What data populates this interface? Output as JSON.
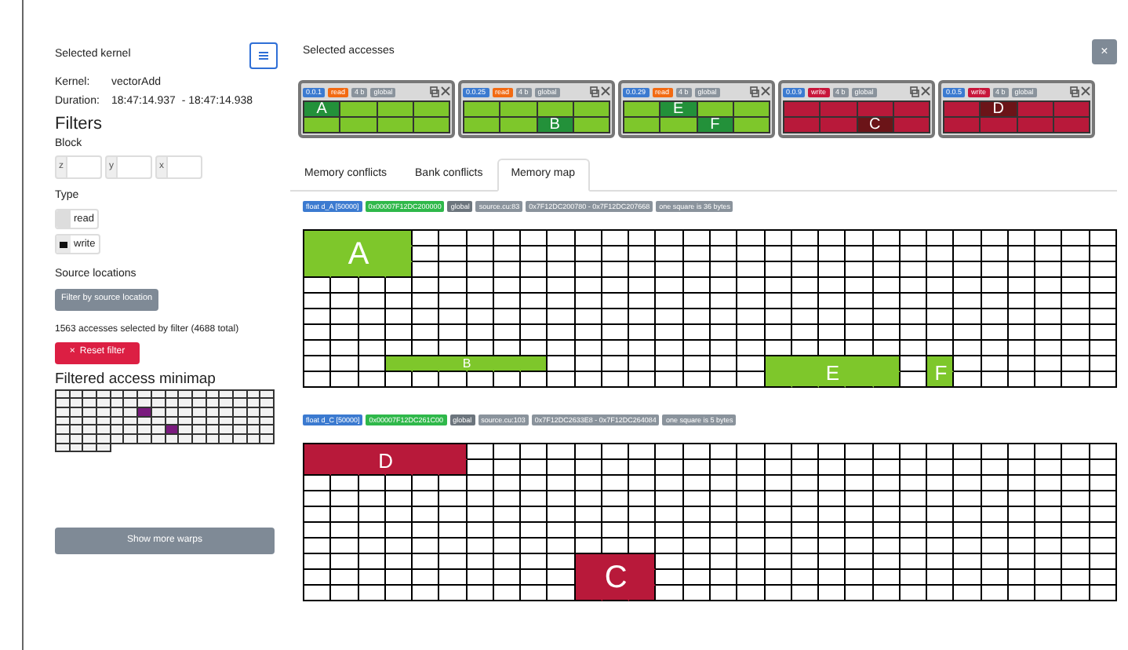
{
  "kernel": {
    "title": "Selected kernel",
    "name_label": "Kernel:",
    "name": "vectorAdd",
    "duration_label": "Duration:",
    "start": "18:47:14.937",
    "end": "- 18:47:14.938"
  },
  "filters": {
    "title": "Filters",
    "block_label": "Block",
    "block_fields": [
      "z",
      "y",
      "x"
    ],
    "type_label": "Type",
    "types": [
      {
        "label": "read",
        "checked": false
      },
      {
        "label": "write",
        "checked": true
      }
    ],
    "source_label": "Source locations",
    "source_button": "Filter by source location",
    "summary": "1563 accesses selected by filter (4688 total)",
    "reset_button": "Reset filter",
    "reset_icon": "×"
  },
  "minimap": {
    "title": "Filtered access minimap",
    "rows": [
      [
        false,
        false,
        false,
        false,
        false,
        false,
        false,
        false,
        false,
        false,
        false,
        false,
        false,
        false,
        false,
        false
      ],
      [
        false,
        false,
        false,
        false,
        false,
        false,
        false,
        false,
        false,
        false,
        false,
        false,
        false,
        false,
        false,
        false
      ],
      [
        false,
        false,
        false,
        false,
        false,
        false,
        true,
        false,
        false,
        false,
        false,
        false,
        false,
        false,
        false,
        false
      ],
      [
        false,
        false,
        false,
        false,
        false,
        false,
        false,
        false,
        false,
        false,
        false,
        false,
        false,
        false,
        false,
        false
      ],
      [
        false,
        false,
        false,
        false,
        false,
        false,
        false,
        false,
        true,
        false,
        false,
        false,
        false,
        false,
        false,
        false
      ],
      [
        false,
        false,
        false,
        false,
        false,
        false,
        false,
        false,
        false,
        false,
        false,
        false,
        false,
        false,
        false,
        false
      ],
      [
        false,
        false,
        false,
        false
      ]
    ]
  },
  "more_button": "Show more warps",
  "accesses": {
    "title": "Selected accesses",
    "close": "×",
    "cards": [
      {
        "thread": "0.0.1",
        "access": "read",
        "size": "4 b",
        "space": "global",
        "labels": [
          "A"
        ],
        "cells": [
          [
            true,
            false,
            false,
            false
          ],
          [
            false,
            false,
            false,
            false
          ]
        ]
      },
      {
        "thread": "0.0.25",
        "access": "read",
        "size": "4 b",
        "space": "global",
        "labels": [
          "B"
        ],
        "cells": [
          [
            false,
            false,
            false,
            false
          ],
          [
            false,
            false,
            true,
            false
          ]
        ]
      },
      {
        "thread": "0.0.29",
        "access": "read",
        "size": "4 b",
        "space": "global",
        "labels": [
          "E",
          "F"
        ],
        "cells": [
          [
            false,
            true,
            false,
            false
          ],
          [
            false,
            false,
            true,
            false
          ]
        ]
      },
      {
        "thread": "0.0.9",
        "access": "write",
        "size": "4 b",
        "space": "global",
        "labels": [
          "C"
        ],
        "cells": [
          [
            false,
            false,
            false,
            false
          ],
          [
            false,
            false,
            true,
            false
          ]
        ]
      },
      {
        "thread": "0.0.5",
        "access": "write",
        "size": "4 b",
        "space": "global",
        "labels": [
          "D"
        ],
        "cells": [
          [
            false,
            true,
            false,
            false
          ],
          [
            false,
            false,
            false,
            false
          ]
        ]
      }
    ]
  },
  "tabs": [
    {
      "label": "Memory conflicts",
      "selected": false
    },
    {
      "label": "Bank conflicts",
      "selected": false
    },
    {
      "label": "Memory map",
      "selected": true
    }
  ],
  "memory_maps": [
    {
      "variable": "float d_A [50000]",
      "base": "0x00007F12DC200000",
      "space": "global",
      "source": "source.cu:83",
      "range": "0x7F12DC200780 - 0x7F12DC207668",
      "scale": "one square is 36 bytes",
      "kind": "read",
      "labels": [
        "A",
        "B",
        "E",
        "F"
      ],
      "cells": [
        [
          true,
          true,
          true,
          true,
          false,
          false,
          false,
          false,
          false,
          false,
          false,
          false,
          false,
          false,
          false,
          false,
          false,
          false,
          false,
          false,
          false,
          false,
          false,
          false,
          false,
          false,
          false,
          false,
          false,
          false
        ],
        [
          true,
          true,
          true,
          true,
          false,
          false,
          false,
          false,
          false,
          false,
          false,
          false,
          false,
          false,
          false,
          false,
          false,
          false,
          false,
          false,
          false,
          false,
          false,
          false,
          false,
          false,
          false,
          false,
          false,
          false
        ],
        [
          true,
          true,
          true,
          true,
          false,
          false,
          false,
          false,
          false,
          false,
          false,
          false,
          false,
          false,
          false,
          false,
          false,
          false,
          false,
          false,
          false,
          false,
          false,
          false,
          false,
          false,
          false,
          false,
          false,
          false
        ],
        [
          false,
          false,
          false,
          false,
          false,
          false,
          false,
          false,
          false,
          false,
          false,
          false,
          false,
          false,
          false,
          false,
          false,
          false,
          false,
          false,
          false,
          false,
          false,
          false,
          false,
          false,
          false,
          false,
          false,
          false
        ],
        [
          false,
          false,
          false,
          false,
          false,
          false,
          false,
          false,
          false,
          false,
          false,
          false,
          false,
          false,
          false,
          false,
          false,
          false,
          false,
          false,
          false,
          false,
          false,
          false,
          false,
          false,
          false,
          false,
          false,
          false
        ],
        [
          false,
          false,
          false,
          false,
          false,
          false,
          false,
          false,
          false,
          false,
          false,
          false,
          false,
          false,
          false,
          false,
          false,
          false,
          false,
          false,
          false,
          false,
          false,
          false,
          false,
          false,
          false,
          false,
          false,
          false
        ],
        [
          false,
          false,
          false,
          false,
          false,
          false,
          false,
          false,
          false,
          false,
          false,
          false,
          false,
          false,
          false,
          false,
          false,
          false,
          false,
          false,
          false,
          false,
          false,
          false,
          false,
          false,
          false,
          false,
          false,
          false
        ],
        [
          false,
          false,
          false,
          false,
          false,
          false,
          false,
          false,
          false,
          false,
          false,
          false,
          false,
          false,
          false,
          false,
          false,
          false,
          false,
          false,
          false,
          false,
          false,
          false,
          false,
          false,
          false,
          false,
          false,
          false
        ],
        [
          false,
          false,
          false,
          true,
          true,
          true,
          true,
          true,
          true,
          false,
          false,
          false,
          false,
          false,
          false,
          false,
          false,
          true,
          true,
          true,
          true,
          true,
          false,
          true,
          false,
          false,
          false,
          false,
          false,
          false
        ],
        [
          false,
          false,
          false,
          false,
          false,
          false,
          false,
          false,
          false,
          false,
          false,
          false,
          false,
          false,
          false,
          false,
          false,
          true,
          true,
          true,
          true,
          true,
          false,
          true,
          false,
          false,
          false,
          false,
          false,
          false
        ]
      ]
    },
    {
      "variable": "float d_C [50000]",
      "base": "0x00007F12DC261C00",
      "space": "global",
      "source": "source.cu:103",
      "range": "0x7F12DC2633E8 - 0x7F12DC264084",
      "scale": "one square is 5 bytes",
      "kind": "write",
      "labels": [
        "D",
        "C"
      ],
      "cells": [
        [
          true,
          true,
          true,
          true,
          true,
          true,
          false,
          false,
          false,
          false,
          false,
          false,
          false,
          false,
          false,
          false,
          false,
          false,
          false,
          false,
          false,
          false,
          false,
          false,
          false,
          false,
          false,
          false,
          false,
          false
        ],
        [
          true,
          true,
          true,
          true,
          true,
          true,
          false,
          false,
          false,
          false,
          false,
          false,
          false,
          false,
          false,
          false,
          false,
          false,
          false,
          false,
          false,
          false,
          false,
          false,
          false,
          false,
          false,
          false,
          false,
          false
        ],
        [
          false,
          false,
          false,
          false,
          false,
          false,
          false,
          false,
          false,
          false,
          false,
          false,
          false,
          false,
          false,
          false,
          false,
          false,
          false,
          false,
          false,
          false,
          false,
          false,
          false,
          false,
          false,
          false,
          false,
          false
        ],
        [
          false,
          false,
          false,
          false,
          false,
          false,
          false,
          false,
          false,
          false,
          false,
          false,
          false,
          false,
          false,
          false,
          false,
          false,
          false,
          false,
          false,
          false,
          false,
          false,
          false,
          false,
          false,
          false,
          false,
          false
        ],
        [
          false,
          false,
          false,
          false,
          false,
          false,
          false,
          false,
          false,
          false,
          false,
          false,
          false,
          false,
          false,
          false,
          false,
          false,
          false,
          false,
          false,
          false,
          false,
          false,
          false,
          false,
          false,
          false,
          false,
          false
        ],
        [
          false,
          false,
          false,
          false,
          false,
          false,
          false,
          false,
          false,
          false,
          false,
          false,
          false,
          false,
          false,
          false,
          false,
          false,
          false,
          false,
          false,
          false,
          false,
          false,
          false,
          false,
          false,
          false,
          false,
          false
        ],
        [
          false,
          false,
          false,
          false,
          false,
          false,
          false,
          false,
          false,
          false,
          false,
          false,
          false,
          false,
          false,
          false,
          false,
          false,
          false,
          false,
          false,
          false,
          false,
          false,
          false,
          false,
          false,
          false,
          false,
          false
        ],
        [
          false,
          false,
          false,
          false,
          false,
          false,
          false,
          false,
          false,
          false,
          true,
          true,
          true,
          false,
          false,
          false,
          false,
          false,
          false,
          false,
          false,
          false,
          false,
          false,
          false,
          false,
          false,
          false,
          false,
          false
        ],
        [
          false,
          false,
          false,
          false,
          false,
          false,
          false,
          false,
          false,
          false,
          true,
          true,
          true,
          false,
          false,
          false,
          false,
          false,
          false,
          false,
          false,
          false,
          false,
          false,
          false,
          false,
          false,
          false,
          false,
          false
        ],
        [
          false,
          false,
          false,
          false,
          false,
          false,
          false,
          false,
          false,
          false,
          true,
          true,
          true,
          false,
          false,
          false,
          false,
          false,
          false,
          false,
          false,
          false,
          false,
          false,
          false,
          false,
          false,
          false,
          false,
          false
        ]
      ]
    }
  ]
}
